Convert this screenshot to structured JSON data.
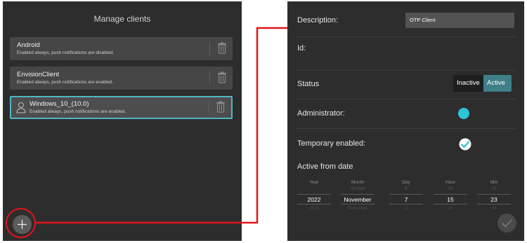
{
  "manage": {
    "title": "Manage clients",
    "clients": [
      {
        "name": "Android",
        "description": "Enabled always, push notifications are disabled.",
        "selected": false
      },
      {
        "name": "EnvisionClient",
        "description": "Enabled always, push notifications are enabled.",
        "selected": false
      },
      {
        "name": "Windows_10_(10.0)",
        "description": "Enabled always, push notifications are enabled.",
        "selected": true
      }
    ],
    "add_icon": "plus-icon",
    "delete_icon": "trash-icon"
  },
  "details": {
    "description_label": "Description:",
    "description_value": "OTP Client",
    "id_label": "Id:",
    "status_label": "Status",
    "status_options": [
      "Inactive",
      "Active"
    ],
    "status_selected": "Active",
    "administrator_label": "Administrator:",
    "administrator_enabled": true,
    "temporary_label": "Temporary enabled:",
    "temporary_enabled": true,
    "active_from_label": "Active from date",
    "date_picker": {
      "columns": [
        {
          "header": "Year",
          "prev": "",
          "current": "2022",
          "next": "2023"
        },
        {
          "header": "Month",
          "prev": "October",
          "current": "November",
          "next": "December"
        },
        {
          "header": "Day",
          "prev": "6",
          "current": "7",
          "next": "8"
        },
        {
          "header": "Hour",
          "prev": "14",
          "current": "15",
          "next": "16"
        },
        {
          "header": "Min",
          "prev": "22",
          "current": "23",
          "next": "24"
        }
      ]
    },
    "confirm_icon": "checkmark-icon"
  },
  "colors": {
    "panel_bg": "#2d2d2d",
    "card_bg": "#464646",
    "accent": "#2ec5d6",
    "active_toggle": "#3e7f88",
    "highlight_ring": "#e1141b"
  }
}
